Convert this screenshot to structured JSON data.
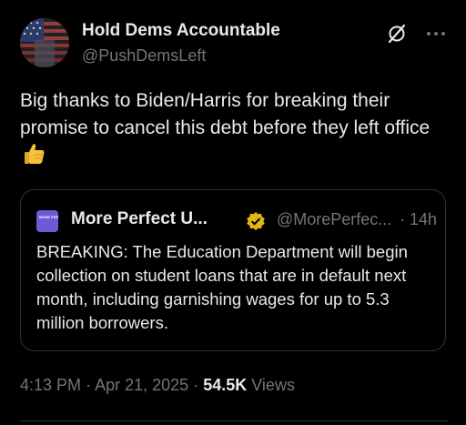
{
  "author": {
    "display_name": "Hold Dems Accountable",
    "handle": "@PushDemsLeft",
    "avatar": "american-flag-avatar"
  },
  "tweet": {
    "text": "Big thanks to Biden/Harris for breaking their promise to cancel this debt before they left office",
    "emoji": "thumbs-up"
  },
  "quote": {
    "logo_text": "MORE PERFECT UNION",
    "display_name": "More Perfect U...",
    "verified": true,
    "handle": "@MorePerfec...",
    "separator": "·",
    "time": "14h",
    "text": "BREAKING: The Education Department will begin collection on student loans that are in default next month, including garnishing wages for up to 5.3 million borrowers."
  },
  "meta": {
    "time": "4:13 PM",
    "sep1": "·",
    "date": "Apr 21, 2025",
    "sep2": "·",
    "views_count": "54.5K",
    "views_label": "Views"
  },
  "colors": {
    "background": "#000000",
    "text": "#e7e9ea",
    "muted": "#71767b",
    "border": "#2f3336",
    "verified_gold": "#e2b719",
    "quote_logo": "#6b5bd6"
  }
}
